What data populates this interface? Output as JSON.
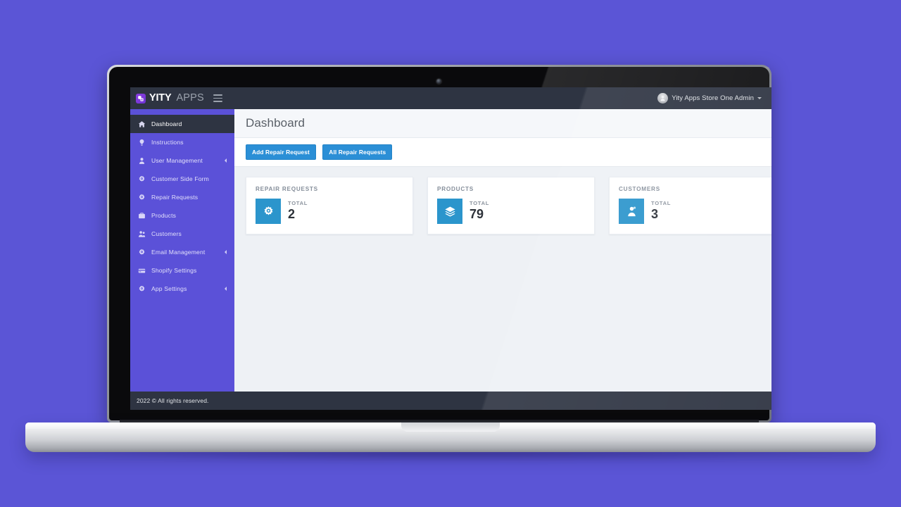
{
  "brand": {
    "name_bold": "YITY",
    "name_light": "APPS",
    "logo_icon": "yity-logo-icon",
    "menu_icon": "hamburger-menu-icon"
  },
  "topbar": {
    "user_name": "Yity Apps Store One Admin",
    "avatar_icon": "user-avatar-icon",
    "caret_icon": "chevron-down-icon"
  },
  "sidebar": {
    "items": [
      {
        "label": "Dashboard",
        "icon": "home-icon",
        "active": true,
        "caret": false
      },
      {
        "label": "Instructions",
        "icon": "lightbulb-icon",
        "active": false,
        "caret": false
      },
      {
        "label": "User Management",
        "icon": "user-icon",
        "active": false,
        "caret": true
      },
      {
        "label": "Customer Side Form",
        "icon": "gear-icon",
        "active": false,
        "caret": false
      },
      {
        "label": "Repair Requests",
        "icon": "gear-icon",
        "active": false,
        "caret": false
      },
      {
        "label": "Products",
        "icon": "briefcase-icon",
        "active": false,
        "caret": false
      },
      {
        "label": "Customers",
        "icon": "users-icon",
        "active": false,
        "caret": false
      },
      {
        "label": "Email Management",
        "icon": "gear-icon",
        "active": false,
        "caret": true
      },
      {
        "label": "Shopify Settings",
        "icon": "credit-card-icon",
        "active": false,
        "caret": false
      },
      {
        "label": "App Settings",
        "icon": "gear-icon",
        "active": false,
        "caret": true
      }
    ]
  },
  "page": {
    "title": "Dashboard"
  },
  "toolbar": {
    "add_repair_request_label": "Add Repair Request",
    "all_repair_requests_label": "All Repair Requests"
  },
  "cards": [
    {
      "title": "REPAIR REQUESTS",
      "total_label": "TOTAL",
      "value": "2",
      "icon": "repair-wheel-icon"
    },
    {
      "title": "PRODUCTS",
      "total_label": "TOTAL",
      "value": "79",
      "icon": "layers-icon"
    },
    {
      "title": "CUSTOMERS",
      "total_label": "TOTAL",
      "value": "3",
      "icon": "customer-icon"
    }
  ],
  "footer": {
    "text": "2022 © All rights reserved."
  },
  "colors": {
    "page_background": "#5b55d6",
    "sidebar": "#5b51d8",
    "topbar": "#2e3442",
    "accent_button": "#2b8fd6",
    "card_icon": "#2b95cc",
    "content_background": "#eef1f5"
  }
}
